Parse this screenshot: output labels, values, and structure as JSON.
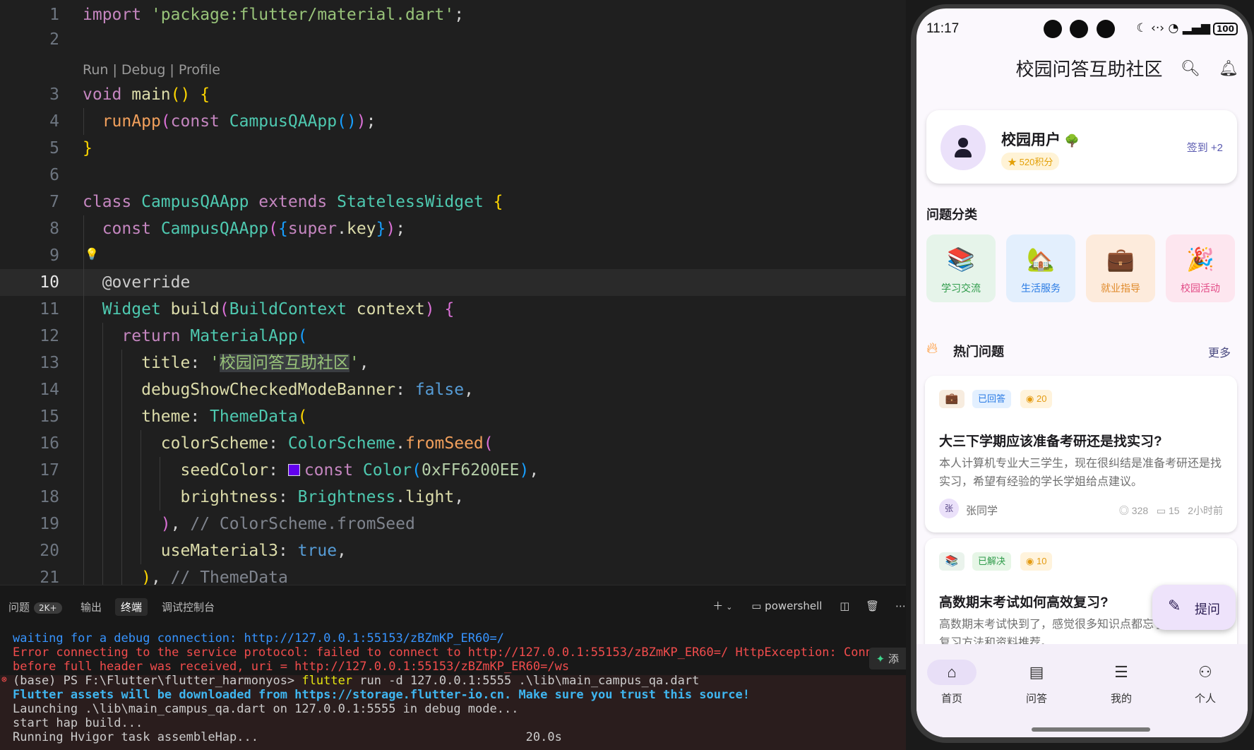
{
  "editor": {
    "codelens": "Run | Debug | Profile",
    "lines": [
      {
        "n": "1",
        "code": "import 'package:flutter/material.dart';"
      },
      {
        "n": "2",
        "code": ""
      },
      {
        "n": "3",
        "code": "void main() {"
      },
      {
        "n": "4",
        "code": "runApp(const CampusQAApp());"
      },
      {
        "n": "5",
        "code": "}"
      },
      {
        "n": "6",
        "code": ""
      },
      {
        "n": "7",
        "code": "class CampusQAApp extends StatelessWidget {"
      },
      {
        "n": "8",
        "code": "const CampusQAApp({super.key});"
      },
      {
        "n": "9",
        "code": ""
      },
      {
        "n": "10",
        "code": "@override"
      },
      {
        "n": "11",
        "code": "Widget build(BuildContext context) {"
      },
      {
        "n": "12",
        "code": "return MaterialApp("
      },
      {
        "n": "13",
        "code": "title: '校园问答互助社区',"
      },
      {
        "n": "14",
        "code": "debugShowCheckedModeBanner: false,"
      },
      {
        "n": "15",
        "code": "theme: ThemeData("
      },
      {
        "n": "16",
        "code": "colorScheme: ColorScheme.fromSeed("
      },
      {
        "n": "17",
        "code": "seedColor: const Color(0xFF6200EE),"
      },
      {
        "n": "18",
        "code": "brightness: Brightness.light,"
      },
      {
        "n": "19",
        "code": "), // ColorScheme.fromSeed"
      },
      {
        "n": "20",
        "code": "useMaterial3: true,"
      },
      {
        "n": "21",
        "code": "), // ThemeData"
      }
    ],
    "seed_color": "#6200EE"
  },
  "panel": {
    "tabs": [
      "问题",
      "输出",
      "终端",
      "调试控制台"
    ],
    "problems_badge": "2K+",
    "active_tab": "终端",
    "shell_label": "powershell",
    "add_label": "添",
    "terminal": [
      "waiting for a debug connection: http://127.0.0.1:55153/zBZmKP_ER60=/",
      "Error connecting to the service protocol: failed to connect to http://127.0.0.1:55153/zBZmKP_ER60=/ HttpException: Connect",
      "before full header was received, uri = http://127.0.0.1:55153/zBZmKP_ER60=/ws",
      "(base) PS F:\\Flutter\\flutter_harmonyos> ",
      "flutter",
      " run -d 127.0.0.1:5555 .\\lib\\main_campus_qa.dart",
      "Flutter assets will be downloaded from https://storage.flutter-io.cn. Make sure you trust this source!",
      "Launching .\\lib\\main_campus_qa.dart on 127.0.0.1:5555 in debug mode...",
      "start hap build...",
      "Running Hvigor task assembleHap...                                     20.0s"
    ]
  },
  "phone": {
    "time": "11:17",
    "battery": "100",
    "title": "校园问答互助社区",
    "user": {
      "name": "校园用户",
      "level_icon": "🌳",
      "points": "520积分",
      "checkin": "签到 +2"
    },
    "categories_title": "问题分类",
    "categories": [
      {
        "emoji": "📚",
        "label": "学习交流",
        "bg": "#e6f4ea",
        "color": "#2e9b4a"
      },
      {
        "emoji": "🏡",
        "label": "生活服务",
        "bg": "#e3effd",
        "color": "#2a7be4"
      },
      {
        "emoji": "💼",
        "label": "就业指导",
        "bg": "#fdebdc",
        "color": "#e08a2a"
      },
      {
        "emoji": "🎉",
        "label": "校园活动",
        "bg": "#fde6ef",
        "color": "#e24a86"
      }
    ],
    "hot_title": "热门问题",
    "more": "更多",
    "questions": [
      {
        "icon": "💼",
        "status": "已回答",
        "reward": "20",
        "title": "大三下学期应该准备考研还是找实习?",
        "desc": "本人计算机专业大三学生，现在很纠结是准备考研还是找实习，希望有经验的学长学姐给点建议。",
        "avatar": "张",
        "author": "张同学",
        "views": "328",
        "comments": "15",
        "time": "2小时前"
      },
      {
        "icon": "📚",
        "status": "已解决",
        "reward": "10",
        "title": "高数期末考试如何高效复习?",
        "desc": "高数期末考试快到了，感觉很多知识点都忘了，求高效的复习方法和资料推荐。"
      }
    ],
    "fab": "提问",
    "nav": [
      {
        "icon": "home-icon",
        "label": "首页"
      },
      {
        "icon": "chat-icon",
        "label": "问答"
      },
      {
        "icon": "article-icon",
        "label": "我的"
      },
      {
        "icon": "person-icon",
        "label": "个人"
      }
    ]
  }
}
